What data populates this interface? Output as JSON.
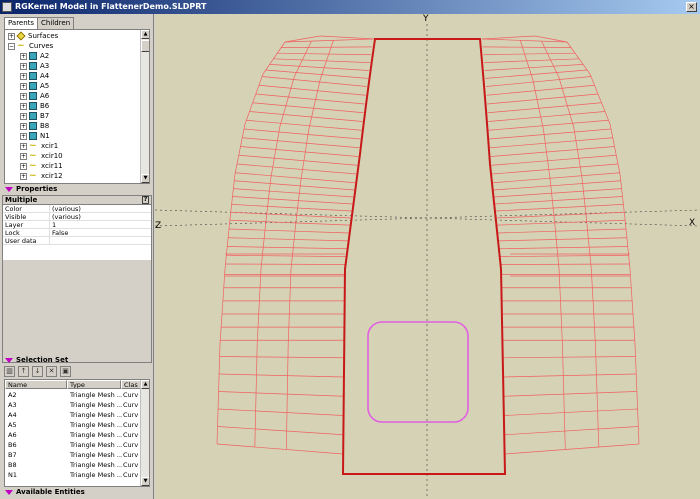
{
  "window": {
    "title": "RGKernel Model in FlattenerDemo.SLDPRT",
    "close_glyph": "×"
  },
  "tabs": [
    {
      "label": "Parents",
      "active": true
    },
    {
      "label": "Children",
      "active": false
    }
  ],
  "tree": {
    "items": [
      {
        "label": "Surfaces",
        "icon": "surface-icon",
        "level": 0,
        "expander": "+"
      },
      {
        "label": "Curves",
        "icon": "curve-icon",
        "level": 0,
        "expander": "−"
      },
      {
        "label": "A2",
        "icon": "mesh-icon",
        "level": 1,
        "expander": "+"
      },
      {
        "label": "A3",
        "icon": "mesh-icon",
        "level": 1,
        "expander": "+"
      },
      {
        "label": "A4",
        "icon": "mesh-icon",
        "level": 1,
        "expander": "+"
      },
      {
        "label": "A5",
        "icon": "mesh-icon",
        "level": 1,
        "expander": "+"
      },
      {
        "label": "A6",
        "icon": "mesh-icon",
        "level": 1,
        "expander": "+"
      },
      {
        "label": "B6",
        "icon": "mesh-icon",
        "level": 1,
        "expander": "+"
      },
      {
        "label": "B7",
        "icon": "mesh-icon",
        "level": 1,
        "expander": "+"
      },
      {
        "label": "B8",
        "icon": "mesh-icon",
        "level": 1,
        "expander": "+"
      },
      {
        "label": "N1",
        "icon": "mesh-icon",
        "level": 1,
        "expander": "+"
      },
      {
        "label": "xcir1",
        "icon": "curve-icon",
        "level": 1,
        "expander": "+"
      },
      {
        "label": "xcir10",
        "icon": "curve-icon",
        "level": 1,
        "expander": "+"
      },
      {
        "label": "xcir11",
        "icon": "curve-icon",
        "level": 1,
        "expander": "+"
      },
      {
        "label": "xcir12",
        "icon": "curve-icon",
        "level": 1,
        "expander": "+"
      }
    ]
  },
  "properties": {
    "header": "Properties",
    "object": "Multiple",
    "rows": [
      {
        "key": "Color",
        "value": "(various)"
      },
      {
        "key": "Visible",
        "value": "(various)"
      },
      {
        "key": "Layer",
        "value": "1"
      },
      {
        "key": "Lock",
        "value": "False"
      },
      {
        "key": "User data",
        "value": ""
      }
    ]
  },
  "selection_set": {
    "header": "Selection Set",
    "columns": [
      "Name",
      "Type",
      "Class"
    ],
    "column_headers_display": [
      "Name",
      "Type",
      "Clas"
    ],
    "rows": [
      {
        "name": "A2",
        "type": "Triangle Mesh ...",
        "class": "Curv"
      },
      {
        "name": "A3",
        "type": "Triangle Mesh ...",
        "class": "Curv"
      },
      {
        "name": "A4",
        "type": "Triangle Mesh ...",
        "class": "Curv"
      },
      {
        "name": "A5",
        "type": "Triangle Mesh ...",
        "class": "Curv"
      },
      {
        "name": "A6",
        "type": "Triangle Mesh ...",
        "class": "Curv"
      },
      {
        "name": "B6",
        "type": "Triangle Mesh ...",
        "class": "Curv"
      },
      {
        "name": "B7",
        "type": "Triangle Mesh ...",
        "class": "Curv"
      },
      {
        "name": "B8",
        "type": "Triangle Mesh ...",
        "class": "Curv"
      },
      {
        "name": "N1",
        "type": "Triangle Mesh ...",
        "class": "Curv"
      }
    ]
  },
  "available_entities": {
    "header": "Available Entities"
  },
  "viewport": {
    "axes": {
      "y": "Y",
      "x": "X",
      "z": "Z"
    },
    "colors": {
      "background": "#d5d2b6",
      "mesh": "#f06060",
      "outline": "#c81818",
      "highlight": "#e060e0",
      "axis": "#404040"
    }
  }
}
